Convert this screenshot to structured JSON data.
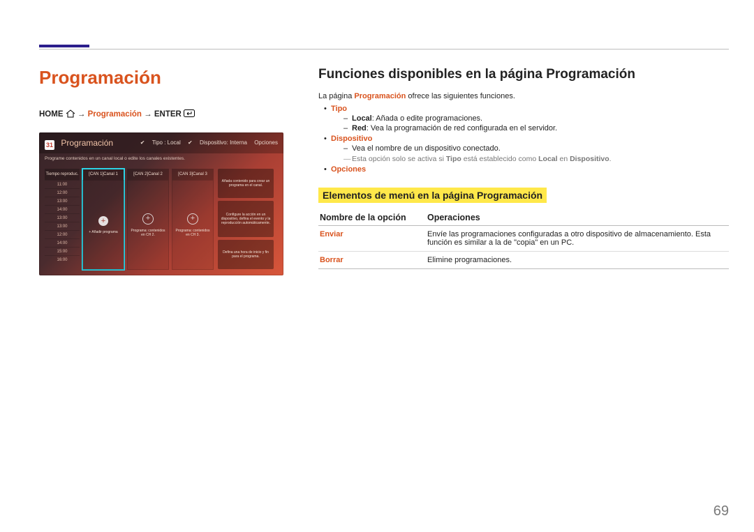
{
  "page_number": "69",
  "section_title": "Programación",
  "breadcrumb": {
    "home": "HOME",
    "mid": "Programación",
    "enter": "ENTER"
  },
  "thumb": {
    "title": "Programación",
    "icon": "31",
    "subtitle": "Programe contenidos en un canal local o edite los canales existentes.",
    "top_right": {
      "tipo": "Tipo : Local",
      "disp": "Dispositivo: Interna",
      "opciones": "Opciones"
    },
    "time_header": "Tiempo reproduc.",
    "times": [
      "11:00",
      "12:00",
      "13:00",
      "14:00",
      "13:00",
      "13:00",
      "12:00",
      "14:00",
      "15:00",
      "16:00"
    ],
    "channels": [
      {
        "name": "[CAN 1]Canal 1",
        "caption": "+ Añadir programa",
        "selected": true,
        "solid": true
      },
      {
        "name": "[CAN 2]Canal 2",
        "caption": "Programa: contenidos en CH 2.",
        "selected": false,
        "solid": false
      },
      {
        "name": "[CAN 3]Canal 3",
        "caption": "Programa: contenidos en CH 3.",
        "selected": false,
        "solid": false
      }
    ],
    "side": [
      "Añada contenido para crear un programa en el canal.",
      "Configure la acción en un dispositivo, defina el evento y la reproducción automáticamente.",
      "Defina una hora de inicio y fin para el programa."
    ]
  },
  "right": {
    "heading": "Funciones disponibles en la página Programación",
    "intro_pre": "La página ",
    "intro_emph": "Programación",
    "intro_post": " ofrece las siguientes funciones.",
    "items": [
      {
        "name": "Tipo",
        "sub": [
          {
            "key": "Local",
            "text": ": Añada o edite programaciones."
          },
          {
            "key": "Red",
            "text": ": Vea la programación de red configurada en el servidor."
          }
        ]
      },
      {
        "name": "Dispositivo",
        "sub": [
          {
            "key": "",
            "text": "Vea el nombre de un dispositivo conectado."
          }
        ],
        "note": {
          "pre": "Esta opción solo se activa si ",
          "b1": "Tipo",
          "mid": " está establecido como ",
          "b2": "Local",
          "mid2": " en ",
          "b3": "Dispositivo",
          "post": "."
        }
      },
      {
        "name": "Opciones"
      }
    ],
    "sub2": "Elementos de menú en la página Programación",
    "th1": "Nombre de la opción",
    "th2": "Operaciones",
    "rows": [
      {
        "name": "Enviar",
        "desc": "Envíe las programaciones configuradas a otro dispositivo de almacenamiento. Esta función es similar a la de \"copia\" en un PC."
      },
      {
        "name": "Borrar",
        "desc": "Elimine programaciones."
      }
    ]
  }
}
